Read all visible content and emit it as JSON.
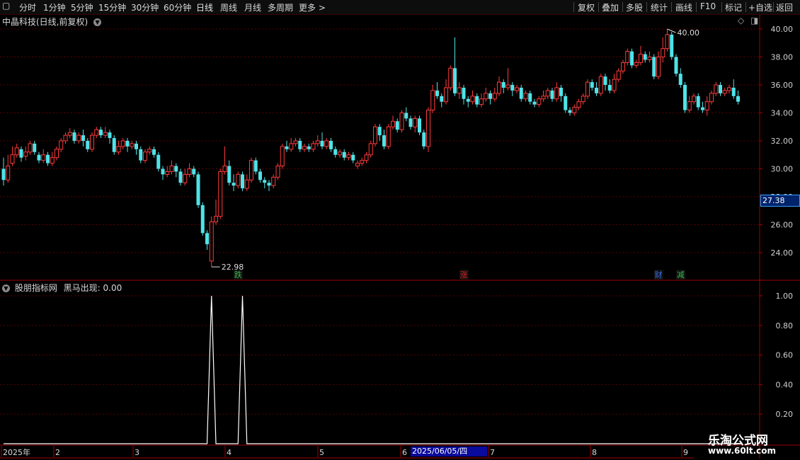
{
  "toolbar": {
    "left_items": [
      "分时",
      "1分钟",
      "5分钟",
      "15分钟",
      "30分钟",
      "60分钟",
      "日线",
      "周线",
      "月线",
      "多周期",
      "更多 >"
    ],
    "active": "日线",
    "right_items": [
      "复权",
      "叠加",
      "多股",
      "统计",
      "画线",
      "F10",
      "标记",
      "+自选",
      "返回"
    ]
  },
  "main_pane": {
    "title": "中晶科技(日线,前复权)",
    "current_price": "27.38",
    "high_label": "40.00",
    "low_label": "22.98",
    "y_axis": [
      "40.00",
      "38.00",
      "36.00",
      "34.00",
      "32.00",
      "30.00",
      "28.00",
      "26.00",
      "24.00"
    ],
    "event_markers": [
      {
        "text": "跌",
        "color": "#3cb44a"
      },
      {
        "text": "涨",
        "color": "#e02020"
      },
      {
        "text": "财",
        "color": "#3a6df0"
      },
      {
        "text": "减",
        "color": "#3cb44a"
      }
    ]
  },
  "indicator_pane": {
    "title": "股朋指标网",
    "series_label": "黑马出现: 0.00",
    "y_axis": [
      "1.00",
      "0.80",
      "0.60",
      "0.40",
      "0.20"
    ]
  },
  "date_axis": {
    "labels": [
      "2025年",
      "2",
      "3",
      "4",
      "5",
      "6",
      "7",
      "8",
      "9"
    ],
    "cursor_date": "2025/06/05/四"
  },
  "watermark": {
    "line1": "乐淘公式网",
    "line2": "www.60lt.com"
  },
  "colors": {
    "up": "#ff3b3b",
    "down": "#4fe3e8",
    "grid": "#5a0000",
    "axis": "#a00000"
  },
  "chart_data": {
    "type": "candlestick",
    "title": "中晶科技(日线,前复权)",
    "ylim": [
      23.0,
      40.5
    ],
    "candles": [
      [
        30.0,
        29.2,
        30.8,
        28.8
      ],
      [
        29.2,
        30.2,
        31.0,
        29.0
      ],
      [
        30.4,
        31.0,
        31.6,
        30.2
      ],
      [
        31.0,
        31.5,
        31.8,
        30.8
      ],
      [
        31.4,
        30.8,
        31.6,
        30.5
      ],
      [
        30.9,
        31.2,
        31.6,
        30.6
      ],
      [
        31.2,
        31.8,
        32.0,
        31.0
      ],
      [
        31.8,
        31.2,
        32.0,
        31.0
      ],
      [
        31.0,
        30.6,
        31.2,
        30.4
      ],
      [
        30.6,
        31.0,
        31.4,
        30.4
      ],
      [
        31.0,
        30.4,
        31.2,
        30.2
      ],
      [
        30.4,
        30.8,
        31.2,
        30.2
      ],
      [
        30.8,
        31.4,
        31.6,
        30.6
      ],
      [
        31.4,
        32.0,
        32.2,
        31.2
      ],
      [
        32.0,
        32.4,
        32.6,
        31.8
      ],
      [
        32.4,
        32.6,
        32.9,
        32.2
      ],
      [
        32.6,
        32.0,
        32.8,
        31.8
      ],
      [
        32.0,
        32.4,
        32.6,
        31.8
      ],
      [
        32.4,
        32.0,
        32.8,
        31.6
      ],
      [
        32.0,
        31.4,
        32.2,
        31.2
      ],
      [
        31.4,
        32.4,
        32.6,
        31.2
      ],
      [
        32.4,
        32.8,
        33.0,
        32.2
      ],
      [
        32.8,
        32.4,
        33.0,
        32.2
      ],
      [
        32.4,
        32.6,
        33.0,
        32.2
      ],
      [
        32.6,
        32.2,
        32.8,
        31.8
      ],
      [
        32.2,
        31.2,
        32.4,
        31.0
      ],
      [
        31.2,
        31.6,
        32.0,
        31.0
      ],
      [
        31.6,
        32.0,
        32.2,
        31.4
      ],
      [
        32.0,
        31.6,
        32.2,
        31.2
      ],
      [
        31.6,
        31.8,
        32.0,
        31.4
      ],
      [
        31.8,
        31.4,
        32.0,
        31.0
      ],
      [
        31.4,
        30.6,
        31.6,
        30.4
      ],
      [
        30.6,
        31.2,
        31.4,
        30.4
      ],
      [
        31.2,
        31.4,
        31.6,
        31.0
      ],
      [
        31.4,
        31.0,
        31.6,
        30.8
      ],
      [
        31.0,
        30.0,
        31.2,
        29.8
      ],
      [
        30.0,
        29.6,
        30.2,
        29.2
      ],
      [
        29.6,
        29.8,
        30.2,
        29.4
      ],
      [
        29.8,
        30.2,
        30.6,
        29.6
      ],
      [
        30.2,
        29.8,
        30.4,
        29.4
      ],
      [
        29.8,
        29.0,
        30.0,
        28.8
      ],
      [
        29.0,
        29.6,
        30.0,
        28.8
      ],
      [
        29.6,
        30.0,
        30.4,
        29.4
      ],
      [
        30.0,
        29.6,
        30.2,
        29.4
      ],
      [
        29.6,
        27.4,
        29.8,
        27.2
      ],
      [
        27.4,
        25.4,
        27.6,
        25.2
      ],
      [
        25.4,
        24.6,
        25.6,
        24.2
      ],
      [
        23.4,
        26.2,
        26.6,
        22.98
      ],
      [
        26.2,
        26.6,
        27.8,
        26.0
      ],
      [
        26.6,
        29.8,
        30.0,
        26.4
      ],
      [
        29.8,
        30.2,
        31.6,
        29.6
      ],
      [
        30.2,
        29.0,
        30.6,
        28.8
      ],
      [
        29.0,
        28.8,
        29.6,
        28.4
      ],
      [
        28.8,
        29.6,
        29.8,
        28.6
      ],
      [
        29.6,
        28.6,
        29.8,
        28.4
      ],
      [
        28.6,
        29.2,
        29.6,
        28.4
      ],
      [
        29.2,
        30.6,
        30.8,
        29.0
      ],
      [
        30.6,
        29.8,
        30.8,
        29.6
      ],
      [
        29.8,
        29.2,
        30.0,
        29.0
      ],
      [
        29.2,
        29.0,
        29.4,
        28.6
      ],
      [
        29.0,
        28.8,
        29.2,
        28.4
      ],
      [
        28.8,
        29.4,
        29.6,
        28.6
      ],
      [
        29.4,
        30.2,
        30.4,
        29.2
      ],
      [
        30.2,
        31.6,
        31.8,
        30.0
      ],
      [
        31.6,
        31.4,
        32.0,
        31.2
      ],
      [
        31.4,
        31.8,
        32.2,
        31.2
      ],
      [
        31.8,
        32.0,
        32.2,
        31.6
      ],
      [
        32.0,
        31.4,
        32.2,
        31.2
      ],
      [
        31.4,
        31.6,
        31.8,
        31.2
      ],
      [
        31.6,
        31.4,
        31.8,
        31.2
      ],
      [
        31.4,
        31.8,
        32.0,
        31.2
      ],
      [
        31.8,
        32.0,
        32.4,
        31.6
      ],
      [
        32.0,
        31.6,
        32.6,
        31.4
      ],
      [
        31.6,
        32.0,
        32.2,
        31.4
      ],
      [
        32.0,
        31.4,
        32.2,
        31.2
      ],
      [
        31.4,
        31.0,
        31.6,
        30.8
      ],
      [
        31.0,
        31.2,
        31.4,
        30.8
      ],
      [
        31.2,
        30.8,
        31.4,
        30.6
      ],
      [
        30.8,
        31.0,
        31.2,
        30.6
      ],
      [
        31.0,
        30.6,
        31.2,
        30.4
      ],
      [
        30.2,
        30.4,
        30.6,
        30.0
      ],
      [
        30.4,
        30.6,
        30.8,
        30.2
      ],
      [
        30.6,
        31.0,
        31.2,
        30.4
      ],
      [
        31.0,
        31.8,
        32.0,
        30.8
      ],
      [
        31.8,
        33.0,
        33.2,
        31.6
      ],
      [
        33.0,
        32.4,
        33.2,
        32.0
      ],
      [
        32.4,
        31.6,
        32.8,
        31.4
      ],
      [
        31.6,
        33.0,
        33.2,
        31.4
      ],
      [
        33.0,
        33.4,
        33.8,
        32.8
      ],
      [
        33.4,
        32.8,
        33.6,
        32.6
      ],
      [
        32.8,
        34.0,
        34.2,
        32.6
      ],
      [
        34.0,
        33.6,
        34.4,
        33.4
      ],
      [
        33.6,
        33.0,
        33.8,
        32.8
      ],
      [
        33.0,
        33.6,
        33.8,
        32.6
      ],
      [
        33.6,
        32.6,
        33.8,
        32.4
      ],
      [
        32.6,
        31.6,
        32.8,
        31.4
      ],
      [
        31.6,
        34.2,
        34.4,
        31.2
      ],
      [
        34.2,
        35.6,
        36.0,
        34.0
      ],
      [
        35.6,
        35.2,
        36.2,
        35.0
      ],
      [
        35.2,
        34.8,
        35.4,
        34.4
      ],
      [
        34.8,
        35.8,
        36.4,
        34.6
      ],
      [
        35.8,
        37.2,
        37.4,
        35.6
      ],
      [
        37.2,
        35.4,
        39.4,
        35.2
      ],
      [
        35.4,
        35.8,
        36.2,
        35.0
      ],
      [
        35.8,
        35.0,
        36.0,
        34.6
      ],
      [
        35.0,
        34.8,
        35.2,
        34.4
      ],
      [
        34.8,
        35.2,
        35.6,
        34.6
      ],
      [
        35.2,
        34.6,
        35.4,
        34.4
      ],
      [
        34.6,
        35.0,
        35.4,
        34.4
      ],
      [
        35.0,
        35.4,
        35.8,
        34.8
      ],
      [
        35.4,
        35.0,
        35.6,
        34.6
      ],
      [
        35.0,
        35.4,
        35.8,
        34.8
      ],
      [
        35.4,
        36.2,
        36.6,
        35.2
      ],
      [
        36.2,
        35.8,
        36.4,
        35.4
      ],
      [
        35.8,
        36.0,
        37.2,
        35.6
      ],
      [
        36.0,
        35.6,
        36.2,
        35.2
      ],
      [
        35.6,
        35.8,
        36.0,
        35.4
      ],
      [
        35.8,
        35.0,
        36.0,
        34.8
      ],
      [
        35.0,
        35.4,
        35.6,
        34.8
      ],
      [
        35.4,
        34.8,
        35.6,
        34.6
      ],
      [
        34.8,
        34.6,
        35.0,
        34.4
      ],
      [
        34.6,
        35.0,
        35.2,
        34.4
      ],
      [
        35.0,
        35.2,
        35.6,
        34.8
      ],
      [
        35.2,
        35.6,
        35.8,
        35.0
      ],
      [
        35.6,
        35.0,
        35.8,
        34.8
      ],
      [
        35.0,
        35.8,
        36.2,
        34.8
      ],
      [
        35.8,
        35.2,
        36.0,
        34.8
      ],
      [
        35.2,
        34.2,
        35.4,
        34.0
      ],
      [
        34.2,
        34.0,
        34.4,
        33.8
      ],
      [
        34.0,
        34.4,
        34.6,
        33.8
      ],
      [
        34.4,
        34.8,
        35.0,
        34.2
      ],
      [
        34.8,
        35.2,
        35.4,
        34.6
      ],
      [
        35.2,
        36.2,
        36.4,
        35.0
      ],
      [
        36.2,
        35.8,
        36.4,
        35.6
      ],
      [
        35.8,
        35.4,
        36.2,
        35.2
      ],
      [
        35.4,
        36.6,
        36.8,
        35.2
      ],
      [
        36.6,
        36.0,
        36.8,
        35.6
      ],
      [
        36.0,
        35.6,
        36.4,
        35.4
      ],
      [
        35.6,
        36.4,
        36.8,
        35.4
      ],
      [
        36.4,
        37.0,
        37.2,
        36.2
      ],
      [
        37.0,
        37.6,
        37.8,
        36.8
      ],
      [
        37.6,
        38.4,
        38.6,
        37.4
      ],
      [
        38.4,
        37.4,
        38.6,
        37.2
      ],
      [
        37.4,
        37.6,
        37.8,
        37.2
      ],
      [
        37.6,
        38.2,
        38.8,
        37.4
      ],
      [
        38.2,
        37.8,
        38.4,
        37.6
      ],
      [
        37.8,
        38.0,
        38.4,
        37.6
      ],
      [
        38.0,
        36.6,
        38.2,
        36.4
      ],
      [
        36.6,
        38.0,
        38.4,
        36.4
      ],
      [
        38.0,
        38.6,
        39.4,
        37.6
      ],
      [
        38.6,
        39.6,
        40.0,
        38.4
      ],
      [
        39.6,
        38.0,
        39.8,
        37.8
      ],
      [
        38.0,
        36.8,
        38.2,
        36.6
      ],
      [
        36.8,
        36.0,
        37.2,
        35.8
      ],
      [
        36.0,
        34.2,
        36.2,
        34.0
      ],
      [
        34.2,
        34.8,
        35.2,
        34.0
      ],
      [
        34.8,
        35.2,
        35.4,
        34.6
      ],
      [
        35.2,
        34.4,
        35.4,
        34.2
      ],
      [
        34.4,
        34.2,
        34.8,
        34.0
      ],
      [
        34.2,
        34.8,
        35.2,
        33.8
      ],
      [
        34.8,
        35.4,
        35.6,
        34.6
      ],
      [
        35.4,
        36.0,
        36.2,
        35.2
      ],
      [
        36.0,
        35.4,
        36.2,
        35.2
      ],
      [
        35.4,
        35.6,
        35.8,
        35.2
      ],
      [
        35.6,
        35.8,
        36.0,
        35.4
      ],
      [
        35.8,
        35.2,
        36.4,
        35.0
      ],
      [
        35.2,
        34.8,
        35.6,
        34.6
      ]
    ],
    "indicator": {
      "series_name": "黑马出现",
      "ylim": [
        0,
        1.0
      ],
      "values": [
        0,
        0,
        0,
        0,
        0,
        0,
        0,
        0,
        0,
        0,
        0,
        0,
        0,
        0,
        0,
        0,
        0,
        0,
        0,
        0,
        0,
        0,
        0,
        0,
        0,
        0,
        0,
        0,
        0,
        0,
        0,
        0,
        0,
        0,
        0,
        0,
        0,
        0,
        0,
        0,
        0,
        0,
        0,
        0,
        0,
        0,
        0,
        1,
        0,
        0,
        0,
        0,
        0,
        0,
        1,
        0,
        0,
        0,
        0,
        0,
        0,
        0,
        0,
        0,
        0,
        0,
        0,
        0,
        0,
        0,
        0,
        0,
        0,
        0,
        0,
        0,
        0,
        0,
        0,
        0,
        0,
        0,
        0,
        0,
        0,
        0,
        0,
        0,
        0,
        0,
        0,
        0,
        0,
        0,
        0,
        0,
        0,
        0,
        0,
        0,
        0,
        0,
        0,
        0,
        0,
        0,
        0,
        0,
        0,
        0,
        0,
        0,
        0,
        0,
        0,
        0,
        0,
        0,
        0,
        0,
        0,
        0,
        0,
        0,
        0,
        0,
        0,
        0,
        0,
        0,
        0,
        0,
        0,
        0,
        0,
        0,
        0,
        0,
        0,
        0,
        0,
        0,
        0,
        0,
        0,
        0,
        0,
        0,
        0,
        0,
        0,
        0,
        0,
        0,
        0,
        0,
        0,
        0,
        0,
        0,
        0,
        0,
        0,
        0,
        0,
        0
      ]
    }
  }
}
